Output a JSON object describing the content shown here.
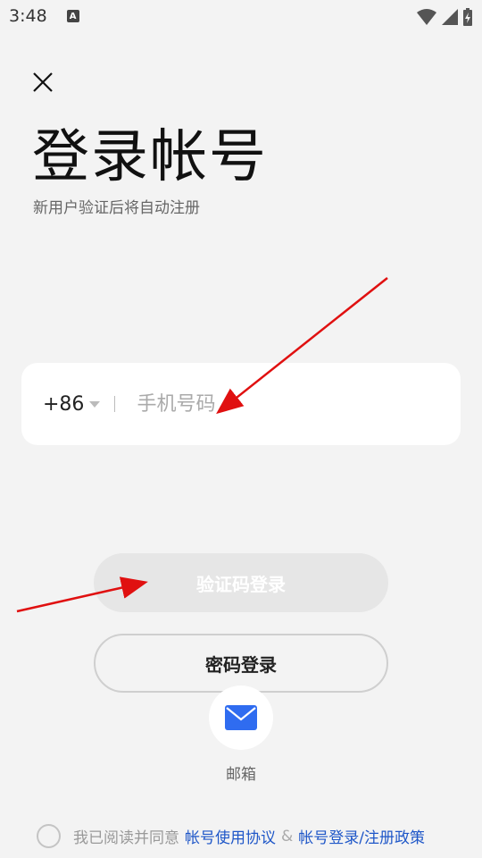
{
  "status_bar": {
    "time": "3:48",
    "notification_letter": "A",
    "icons": [
      "wifi-icon",
      "signal-icon",
      "battery-charging-icon"
    ]
  },
  "header": {
    "close_icon": "close-icon",
    "title": "登录帐号",
    "subtitle": "新用户验证后将自动注册"
  },
  "phone": {
    "country_code": "+86",
    "separator": "|",
    "placeholder": "手机号码",
    "value": ""
  },
  "buttons": {
    "code_login": "验证码登录",
    "password_login": "密码登录"
  },
  "email": {
    "icon": "mail-icon",
    "label": "邮箱",
    "accent": "#2f6cf0"
  },
  "agreement": {
    "prefix": "我已阅读并同意",
    "link_terms": "帐号使用协议",
    "amp": "&",
    "link_policy": "帐号登录/注册政策"
  },
  "colors": {
    "background": "#f3f3f3",
    "link": "#1f57c8",
    "annotation_arrow": "#e01010"
  }
}
